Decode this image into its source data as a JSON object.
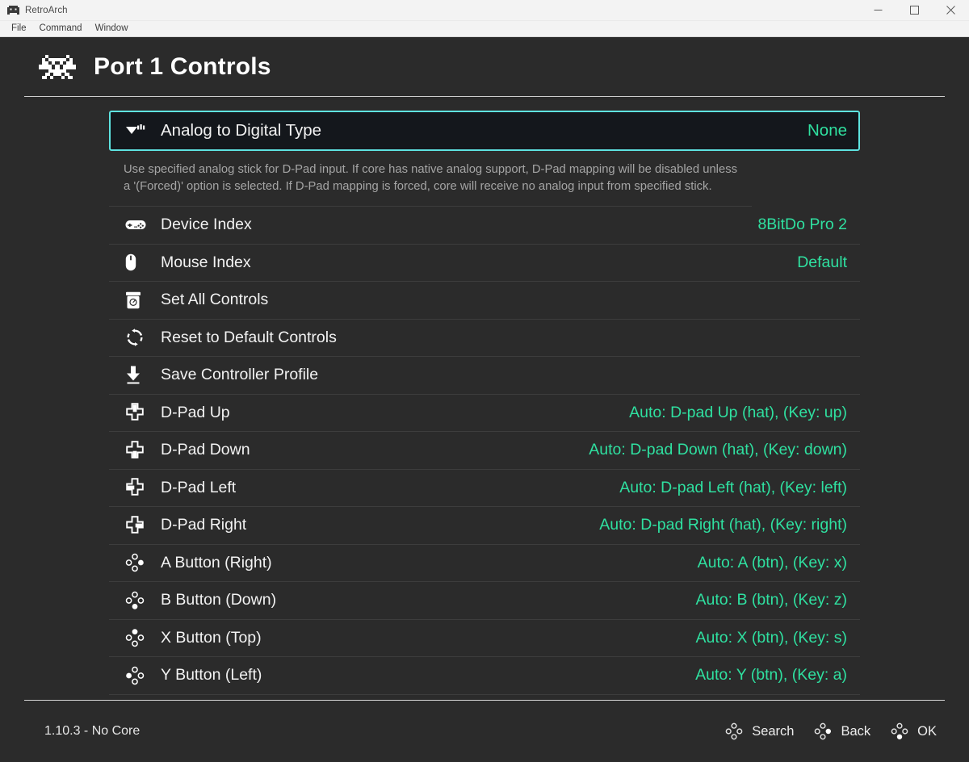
{
  "window": {
    "title": "RetroArch",
    "icon": "retroarch-icon",
    "controls": [
      {
        "name": "minimize-button",
        "glyph": "minimize"
      },
      {
        "name": "maximize-button",
        "glyph": "maximize"
      },
      {
        "name": "close-button",
        "glyph": "close"
      }
    ],
    "menubar": [
      "File",
      "Command",
      "Window"
    ]
  },
  "header": {
    "logo": "retroarch-alien-logo",
    "title": "Port 1 Controls"
  },
  "colors": {
    "accent_value": "#2fe0a0",
    "selection_border": "#5ee2e0",
    "selection_bg": "#14171c",
    "app_bg": "#2b2b2b",
    "label": "#f2f2f2",
    "help_text": "#a5a5a5"
  },
  "selected_item": {
    "icon": "analog-stick-icon",
    "label": "Analog to Digital Type",
    "value": "None",
    "help": "Use specified analog stick for D-Pad input. If core has native analog support, D-Pad mapping will be disabled unless a '(Forced)' option is selected. If D-Pad mapping is forced, core will receive no analog input from specified stick."
  },
  "items": [
    {
      "icon": "gamepad-icon",
      "label": "Device Index",
      "value": "8BitDo Pro 2"
    },
    {
      "icon": "mouse-icon",
      "label": "Mouse Index",
      "value": "Default"
    },
    {
      "icon": "set-all-icon",
      "label": "Set All Controls",
      "value": ""
    },
    {
      "icon": "reset-icon",
      "label": "Reset to Default Controls",
      "value": ""
    },
    {
      "icon": "download-icon",
      "label": "Save Controller Profile",
      "value": ""
    },
    {
      "icon": "dpad-up-icon",
      "label": "D-Pad Up",
      "value": "Auto:  D-pad Up (hat), (Key: up)"
    },
    {
      "icon": "dpad-down-icon",
      "label": "D-Pad Down",
      "value": "Auto:  D-pad Down (hat), (Key: down)"
    },
    {
      "icon": "dpad-left-icon",
      "label": "D-Pad Left",
      "value": "Auto:  D-pad Left (hat), (Key: left)"
    },
    {
      "icon": "dpad-right-icon",
      "label": "D-Pad Right",
      "value": "Auto:  D-pad Right (hat), (Key: right)"
    },
    {
      "icon": "button-right-icon",
      "label": "A Button (Right)",
      "value": "Auto:  A (btn), (Key: x)"
    },
    {
      "icon": "button-down-icon",
      "label": "B Button (Down)",
      "value": "Auto:  B (btn), (Key: z)"
    },
    {
      "icon": "button-up-icon",
      "label": "X Button (Top)",
      "value": "Auto:  X (btn), (Key: s)"
    },
    {
      "icon": "button-left-icon",
      "label": "Y Button (Left)",
      "value": "Auto:  Y (btn), (Key: a)"
    }
  ],
  "footer": {
    "status": "1.10.3 - No Core",
    "actions": [
      {
        "icon": "button-none-icon",
        "label": "Search"
      },
      {
        "icon": "button-right-icon",
        "label": "Back"
      },
      {
        "icon": "button-down-icon",
        "label": "OK"
      }
    ]
  }
}
